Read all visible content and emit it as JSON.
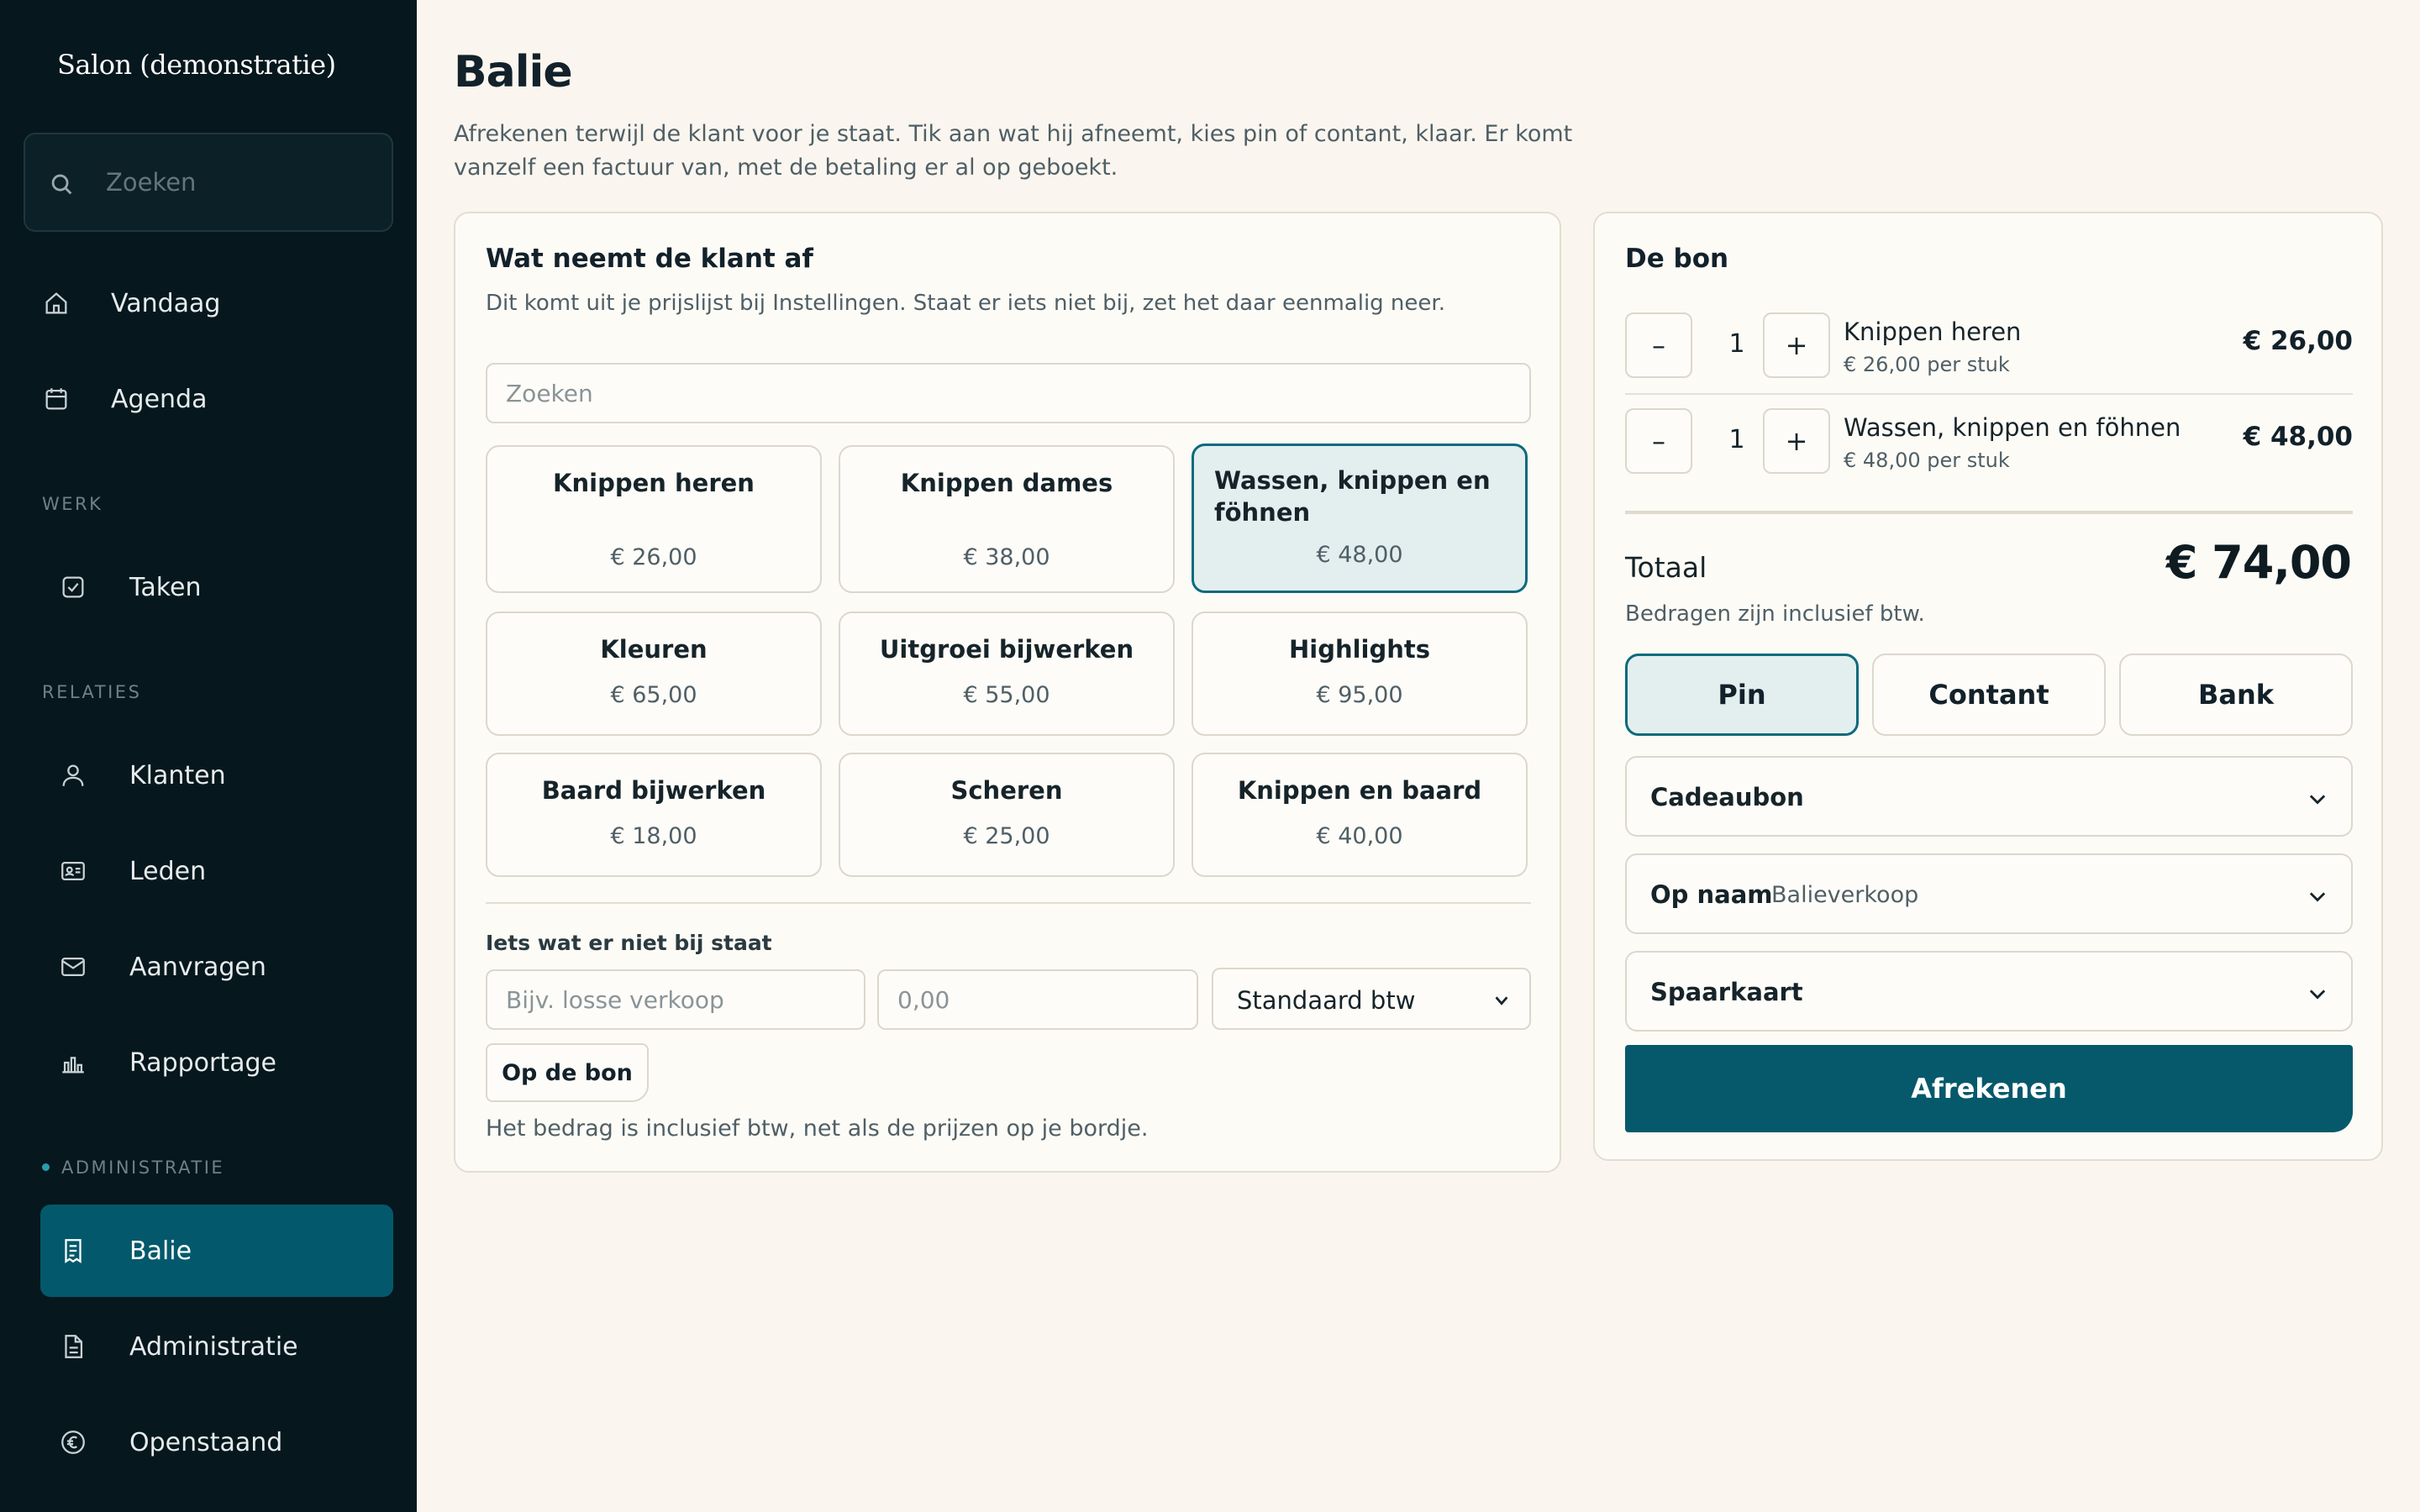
{
  "app": {
    "brand": "Salon (demonstratie)"
  },
  "sidebar": {
    "search_placeholder": "Zoeken",
    "top_items": [
      {
        "label": "Vandaag",
        "icon": "home-icon"
      },
      {
        "label": "Agenda",
        "icon": "calendar-icon"
      }
    ],
    "section_werk": "WERK",
    "werk_items": [
      {
        "label": "Taken",
        "icon": "checkbox-icon"
      }
    ],
    "section_relaties": "RELATIES",
    "relaties_items": [
      {
        "label": "Klanten",
        "icon": "user-icon"
      },
      {
        "label": "Leden",
        "icon": "id-card-icon"
      },
      {
        "label": "Aanvragen",
        "icon": "mail-icon"
      },
      {
        "label": "Rapportage",
        "icon": "bar-chart-icon"
      }
    ],
    "section_administratie": "ADMINISTRATIE",
    "administratie_items": [
      {
        "label": "Balie",
        "icon": "receipt-icon",
        "active": true
      },
      {
        "label": "Administratie",
        "icon": "document-icon"
      },
      {
        "label": "Openstaand",
        "icon": "euro-icon"
      }
    ]
  },
  "page": {
    "title": "Balie",
    "subtitle": "Afrekenen terwijl de klant voor je staat. Tik aan wat hij afneemt, kies pin of contant, klaar. Er komt vanzelf een factuur van, met de betaling er al op geboekt."
  },
  "services": {
    "title": "Wat neemt de klant af",
    "subtitle": "Dit komt uit je prijslijst bij Instellingen. Staat er iets niet bij, zet het daar eenmalig neer.",
    "search_placeholder": "Zoeken",
    "items": [
      {
        "name": "Knippen heren",
        "price": "€ 26,00"
      },
      {
        "name": "Knippen dames",
        "price": "€ 38,00"
      },
      {
        "name": "Wassen, knippen en föhnen",
        "price": "€ 48,00",
        "selected": true
      },
      {
        "name": "Kleuren",
        "price": "€ 65,00"
      },
      {
        "name": "Uitgroei bijwerken",
        "price": "€ 55,00"
      },
      {
        "name": "Highlights",
        "price": "€ 95,00"
      },
      {
        "name": "Baard bijwerken",
        "price": "€ 18,00"
      },
      {
        "name": "Scheren",
        "price": "€ 25,00"
      },
      {
        "name": "Knippen en baard",
        "price": "€ 40,00"
      }
    ],
    "extra": {
      "label": "Iets wat er niet bij staat",
      "description_placeholder": "Bijv. losse verkoop",
      "amount_placeholder": "0,00",
      "vat_selected": "Standaard btw",
      "add_button": "Op de bon",
      "note": "Het bedrag is inclusief btw, net als de prijzen op je bordje."
    }
  },
  "receipt": {
    "title": "De bon",
    "minus_label": "–",
    "plus_label": "+",
    "lines": [
      {
        "qty": "1",
        "name": "Knippen heren",
        "unit": "€ 26,00 per stuk",
        "total": "€ 26,00"
      },
      {
        "qty": "1",
        "name": "Wassen, knippen en föhnen",
        "unit": "€ 48,00 per stuk",
        "total": "€ 48,00"
      }
    ],
    "total_label": "Totaal",
    "total_value": "€ 74,00",
    "total_note": "Bedragen zijn inclusief btw.",
    "payment_methods": [
      {
        "label": "Pin",
        "active": true
      },
      {
        "label": "Contant"
      },
      {
        "label": "Bank"
      }
    ],
    "giftcard_label": "Cadeaubon",
    "customer_label": "Op naam",
    "customer_value": "Balieverkoop",
    "loyalty_label": "Spaarkaart",
    "checkout_label": "Afrekenen"
  },
  "colors": {
    "sidebar_bg": "#06171d",
    "accent": "#05596b",
    "page_bg": "#faf6ef",
    "selected_bg": "#e3eeef"
  }
}
